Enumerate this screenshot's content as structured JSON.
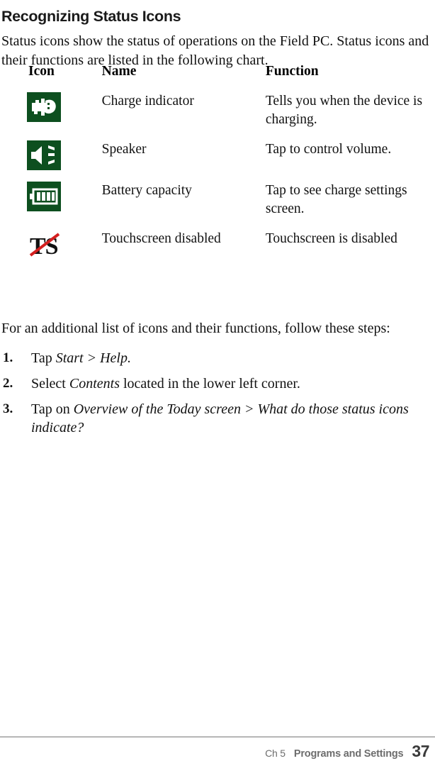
{
  "page": {
    "section_title": "Recognizing Status Icons",
    "intro": "Status icons show the status of operations on the Field PC. Status icons and their functions are listed in the following chart.",
    "followup": "For an additional list of icons and their functions, follow these steps:"
  },
  "table": {
    "headers": {
      "icon": "Icon",
      "name": "Name",
      "function": "Function"
    },
    "rows": [
      {
        "icon_name": "charge-indicator-icon",
        "icon_bg": "#0d4f1f",
        "name": "Charge indicator",
        "function": "Tells you when the device is charging."
      },
      {
        "icon_name": "speaker-icon",
        "icon_bg": "#0d4f1f",
        "name": "Speaker",
        "function": "Tap to control volume."
      },
      {
        "icon_name": "battery-capacity-icon",
        "icon_bg": "#0d4f1f",
        "name": "Battery capacity",
        "function": "Tap to see charge settings screen."
      },
      {
        "icon_name": "touchscreen-disabled-icon",
        "icon_bg": "#ffffff",
        "name": "Touchscreen disabled",
        "function": "Touchscreen is disabled"
      }
    ]
  },
  "steps": [
    {
      "number": "1.",
      "parts": [
        {
          "text": "Tap ",
          "style": "normal"
        },
        {
          "text": "Start > Help.",
          "style": "italic"
        }
      ]
    },
    {
      "number": "2.",
      "parts": [
        {
          "text": "Select ",
          "style": "normal"
        },
        {
          "text": "Contents",
          "style": "italic"
        },
        {
          "text": " located in the lower left corner.",
          "style": "normal"
        }
      ]
    },
    {
      "number": "3.",
      "parts": [
        {
          "text": "Tap on ",
          "style": "normal"
        },
        {
          "text": "Overview of the Today screen > What do those status icons indicate?",
          "style": "italic"
        }
      ]
    }
  ],
  "footer": {
    "chapter": "Ch 5",
    "section": "Programs and Settings",
    "page_number": "37",
    "rule_color": "#b6b6b6"
  }
}
